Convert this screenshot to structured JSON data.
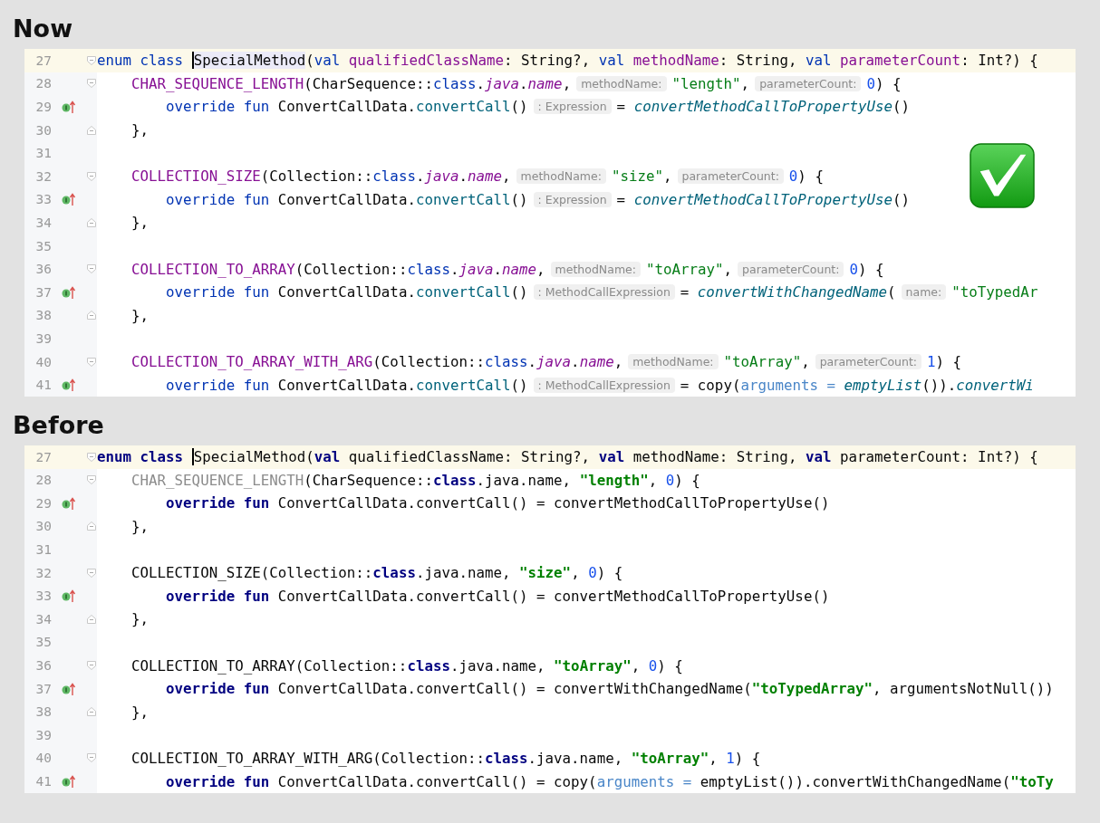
{
  "panels": [
    {
      "heading": "Now",
      "approved": true,
      "lines": [
        {
          "number": "27",
          "current": true,
          "override": false,
          "fold_start": true,
          "fold_end": false,
          "segments": [
            {
              "kind": "code",
              "tokens": [
                {
                  "kind": "kw",
                  "s": "enum class "
                },
                {
                  "kind": "sel",
                  "s": "SpecialMethod",
                  "cursor": true
                },
                {
                  "kind": "plain",
                  "s": "("
                },
                {
                  "kind": "kw",
                  "s": "val "
                },
                {
                  "kind": "enum",
                  "s": "qualifiedClassName"
                },
                {
                  "kind": "plain",
                  "s": ": String?, "
                },
                {
                  "kind": "kw",
                  "s": "val "
                },
                {
                  "kind": "enum",
                  "s": "methodName"
                },
                {
                  "kind": "plain",
                  "s": ": String, "
                },
                {
                  "kind": "kw",
                  "s": "val "
                },
                {
                  "kind": "enum",
                  "s": "parameterCount"
                },
                {
                  "kind": "plain",
                  "s": ": Int?) {"
                }
              ]
            }
          ]
        },
        {
          "number": "28",
          "current": false,
          "override": false,
          "fold_start": true,
          "fold_end": false,
          "segments": [
            {
              "kind": "code",
              "tokens": [
                {
                  "kind": "enum",
                  "s": "    CHAR_SEQUENCE_LENGTH"
                },
                {
                  "kind": "plain",
                  "s": "(CharSequence::"
                },
                {
                  "kind": "kw",
                  "s": "class"
                },
                {
                  "kind": "plain",
                  "s": "."
                },
                {
                  "kind": "ital",
                  "s": "java"
                },
                {
                  "kind": "plain",
                  "s": "."
                },
                {
                  "kind": "ital",
                  "s": "name"
                },
                {
                  "kind": "plain",
                  "s": ","
                }
              ]
            },
            {
              "kind": "hint",
              "text": "methodName:"
            },
            {
              "kind": "code",
              "tokens": [
                {
                  "kind": "str",
                  "s": "\"length\""
                },
                {
                  "kind": "plain",
                  "s": ","
                }
              ]
            },
            {
              "kind": "hint",
              "text": "parameterCount:"
            },
            {
              "kind": "code",
              "tokens": [
                {
                  "kind": "num",
                  "s": "0"
                },
                {
                  "kind": "plain",
                  "s": ") {"
                }
              ]
            }
          ]
        },
        {
          "number": "29",
          "current": false,
          "override": true,
          "fold_start": false,
          "fold_end": false,
          "segments": [
            {
              "kind": "code",
              "tokens": [
                {
                  "kind": "kw",
                  "s": "        override fun "
                },
                {
                  "kind": "plain",
                  "s": "ConvertCallData."
                },
                {
                  "kind": "fn",
                  "s": "convertCall"
                },
                {
                  "kind": "plain",
                  "s": "()"
                }
              ]
            },
            {
              "kind": "hint",
              "text": ": Expression"
            },
            {
              "kind": "code",
              "tokens": [
                {
                  "kind": "plain",
                  "s": "= "
                },
                {
                  "kind": "fni",
                  "s": "convertMethodCallToPropertyUse"
                },
                {
                  "kind": "plain",
                  "s": "()"
                }
              ]
            }
          ]
        },
        {
          "number": "30",
          "current": false,
          "override": false,
          "fold_start": false,
          "fold_end": true,
          "segments": [
            {
              "kind": "code",
              "tokens": [
                {
                  "kind": "plain",
                  "s": "    },"
                }
              ]
            }
          ]
        },
        {
          "number": "31",
          "current": false,
          "override": false,
          "fold_start": false,
          "fold_end": false
        },
        {
          "number": "32",
          "current": false,
          "override": false,
          "fold_start": true,
          "fold_end": false,
          "segments": [
            {
              "kind": "code",
              "tokens": [
                {
                  "kind": "enum",
                  "s": "    COLLECTION_SIZE"
                },
                {
                  "kind": "plain",
                  "s": "(Collection::"
                },
                {
                  "kind": "kw",
                  "s": "class"
                },
                {
                  "kind": "plain",
                  "s": "."
                },
                {
                  "kind": "ital",
                  "s": "java"
                },
                {
                  "kind": "plain",
                  "s": "."
                },
                {
                  "kind": "ital",
                  "s": "name"
                },
                {
                  "kind": "plain",
                  "s": ","
                }
              ]
            },
            {
              "kind": "hint",
              "text": "methodName:"
            },
            {
              "kind": "code",
              "tokens": [
                {
                  "kind": "str",
                  "s": "\"size\""
                },
                {
                  "kind": "plain",
                  "s": ","
                }
              ]
            },
            {
              "kind": "hint",
              "text": "parameterCount:"
            },
            {
              "kind": "code",
              "tokens": [
                {
                  "kind": "num",
                  "s": "0"
                },
                {
                  "kind": "plain",
                  "s": ") {"
                }
              ]
            }
          ]
        },
        {
          "number": "33",
          "current": false,
          "override": true,
          "fold_start": false,
          "fold_end": false,
          "segments": [
            {
              "kind": "code",
              "tokens": [
                {
                  "kind": "kw",
                  "s": "        override fun "
                },
                {
                  "kind": "plain",
                  "s": "ConvertCallData."
                },
                {
                  "kind": "fn",
                  "s": "convertCall"
                },
                {
                  "kind": "plain",
                  "s": "()"
                }
              ]
            },
            {
              "kind": "hint",
              "text": ": Expression"
            },
            {
              "kind": "code",
              "tokens": [
                {
                  "kind": "plain",
                  "s": "= "
                },
                {
                  "kind": "fni",
                  "s": "convertMethodCallToPropertyUse"
                },
                {
                  "kind": "plain",
                  "s": "()"
                }
              ]
            }
          ]
        },
        {
          "number": "34",
          "current": false,
          "override": false,
          "fold_start": false,
          "fold_end": true,
          "segments": [
            {
              "kind": "code",
              "tokens": [
                {
                  "kind": "plain",
                  "s": "    },"
                }
              ]
            }
          ]
        },
        {
          "number": "35",
          "current": false,
          "override": false,
          "fold_start": false,
          "fold_end": false
        },
        {
          "number": "36",
          "current": false,
          "override": false,
          "fold_start": true,
          "fold_end": false,
          "segments": [
            {
              "kind": "code",
              "tokens": [
                {
                  "kind": "enum",
                  "s": "    COLLECTION_TO_ARRAY"
                },
                {
                  "kind": "plain",
                  "s": "(Collection::"
                },
                {
                  "kind": "kw",
                  "s": "class"
                },
                {
                  "kind": "plain",
                  "s": "."
                },
                {
                  "kind": "ital",
                  "s": "java"
                },
                {
                  "kind": "plain",
                  "s": "."
                },
                {
                  "kind": "ital",
                  "s": "name"
                },
                {
                  "kind": "plain",
                  "s": ","
                }
              ]
            },
            {
              "kind": "hint",
              "text": "methodName:"
            },
            {
              "kind": "code",
              "tokens": [
                {
                  "kind": "str",
                  "s": "\"toArray\""
                },
                {
                  "kind": "plain",
                  "s": ","
                }
              ]
            },
            {
              "kind": "hint",
              "text": "parameterCount:"
            },
            {
              "kind": "code",
              "tokens": [
                {
                  "kind": "num",
                  "s": "0"
                },
                {
                  "kind": "plain",
                  "s": ") {"
                }
              ]
            }
          ]
        },
        {
          "number": "37",
          "current": false,
          "override": true,
          "fold_start": false,
          "fold_end": false,
          "segments": [
            {
              "kind": "code",
              "tokens": [
                {
                  "kind": "kw",
                  "s": "        override fun "
                },
                {
                  "kind": "plain",
                  "s": "ConvertCallData."
                },
                {
                  "kind": "fn",
                  "s": "convertCall"
                },
                {
                  "kind": "plain",
                  "s": "()"
                }
              ]
            },
            {
              "kind": "hint",
              "text": ": MethodCallExpression"
            },
            {
              "kind": "code",
              "tokens": [
                {
                  "kind": "plain",
                  "s": "= "
                },
                {
                  "kind": "fni",
                  "s": "convertWithChangedName"
                },
                {
                  "kind": "plain",
                  "s": "("
                }
              ]
            },
            {
              "kind": "hint",
              "text": "name:"
            },
            {
              "kind": "code",
              "tokens": [
                {
                  "kind": "str",
                  "s": "\"toTypedAr"
                }
              ]
            }
          ]
        },
        {
          "number": "38",
          "current": false,
          "override": false,
          "fold_start": false,
          "fold_end": true,
          "segments": [
            {
              "kind": "code",
              "tokens": [
                {
                  "kind": "plain",
                  "s": "    },"
                }
              ]
            }
          ]
        },
        {
          "number": "39",
          "current": false,
          "override": false,
          "fold_start": false,
          "fold_end": false
        },
        {
          "number": "40",
          "current": false,
          "override": false,
          "fold_start": true,
          "fold_end": false,
          "segments": [
            {
              "kind": "code",
              "tokens": [
                {
                  "kind": "enum",
                  "s": "    COLLECTION_TO_ARRAY_WITH_ARG"
                },
                {
                  "kind": "plain",
                  "s": "(Collection::"
                },
                {
                  "kind": "kw",
                  "s": "class"
                },
                {
                  "kind": "plain",
                  "s": "."
                },
                {
                  "kind": "ital",
                  "s": "java"
                },
                {
                  "kind": "plain",
                  "s": "."
                },
                {
                  "kind": "ital",
                  "s": "name"
                },
                {
                  "kind": "plain",
                  "s": ","
                }
              ]
            },
            {
              "kind": "hint",
              "text": "methodName:"
            },
            {
              "kind": "code",
              "tokens": [
                {
                  "kind": "str",
                  "s": "\"toArray\""
                },
                {
                  "kind": "plain",
                  "s": ","
                }
              ]
            },
            {
              "kind": "hint",
              "text": "parameterCount:"
            },
            {
              "kind": "code",
              "tokens": [
                {
                  "kind": "num",
                  "s": "1"
                },
                {
                  "kind": "plain",
                  "s": ") {"
                }
              ]
            }
          ]
        },
        {
          "number": "41",
          "current": false,
          "override": true,
          "fold_start": false,
          "fold_end": false,
          "segments": [
            {
              "kind": "code",
              "tokens": [
                {
                  "kind": "kw",
                  "s": "        override fun "
                },
                {
                  "kind": "plain",
                  "s": "ConvertCallData."
                },
                {
                  "kind": "fn",
                  "s": "convertCall"
                },
                {
                  "kind": "plain",
                  "s": "()"
                }
              ]
            },
            {
              "kind": "hint",
              "text": ": MethodCallExpression"
            },
            {
              "kind": "code",
              "tokens": [
                {
                  "kind": "plain",
                  "s": "= copy("
                },
                {
                  "kind": "named",
                  "s": "arguments = "
                },
                {
                  "kind": "fni",
                  "s": "emptyList"
                },
                {
                  "kind": "plain",
                  "s": "())."
                },
                {
                  "kind": "fni",
                  "s": "convertWi"
                }
              ]
            }
          ]
        }
      ]
    },
    {
      "heading": "Before",
      "approved": false,
      "lines": [
        {
          "number": "27",
          "current": true,
          "override": false,
          "fold_start": true,
          "fold_end": false,
          "segments": [
            {
              "kind": "code",
              "tokens": [
                {
                  "kind": "kwb",
                  "s": "enum class "
                },
                {
                  "kind": "plain",
                  "s": "SpecialMethod",
                  "cursor": true
                },
                {
                  "kind": "plain",
                  "s": "("
                },
                {
                  "kind": "kwb",
                  "s": "val "
                },
                {
                  "kind": "plain",
                  "s": "qualifiedClassName: String?, "
                },
                {
                  "kind": "kwb",
                  "s": "val "
                },
                {
                  "kind": "plain",
                  "s": "methodName: String, "
                },
                {
                  "kind": "kwb",
                  "s": "val "
                },
                {
                  "kind": "plain",
                  "s": "parameterCount: Int?) {"
                }
              ]
            }
          ]
        },
        {
          "number": "28",
          "current": false,
          "override": false,
          "fold_start": true,
          "fold_end": false,
          "segments": [
            {
              "kind": "code",
              "tokens": [
                {
                  "kind": "unused",
                  "s": "    CHAR_SEQUENCE_LENGTH"
                },
                {
                  "kind": "plain",
                  "s": "(CharSequence::"
                },
                {
                  "kind": "kwb",
                  "s": "class"
                },
                {
                  "kind": "plain",
                  "s": ".java.name, "
                },
                {
                  "kind": "strb",
                  "s": "\"length\""
                },
                {
                  "kind": "plain",
                  "s": ", "
                },
                {
                  "kind": "num",
                  "s": "0"
                },
                {
                  "kind": "plain",
                  "s": ") {"
                }
              ]
            }
          ]
        },
        {
          "number": "29",
          "current": false,
          "override": true,
          "fold_start": false,
          "fold_end": false,
          "segments": [
            {
              "kind": "code",
              "tokens": [
                {
                  "kind": "kwb",
                  "s": "        override fun "
                },
                {
                  "kind": "plain",
                  "s": "ConvertCallData.convertCall() = convertMethodCallToPropertyUse()"
                }
              ]
            }
          ]
        },
        {
          "number": "30",
          "current": false,
          "override": false,
          "fold_start": false,
          "fold_end": true,
          "segments": [
            {
              "kind": "code",
              "tokens": [
                {
                  "kind": "plain",
                  "s": "    },"
                }
              ]
            }
          ]
        },
        {
          "number": "31",
          "current": false,
          "override": false,
          "fold_start": false,
          "fold_end": false
        },
        {
          "number": "32",
          "current": false,
          "override": false,
          "fold_start": true,
          "fold_end": false,
          "segments": [
            {
              "kind": "code",
              "tokens": [
                {
                  "kind": "plain",
                  "s": "    COLLECTION_SIZE(Collection::"
                },
                {
                  "kind": "kwb",
                  "s": "class"
                },
                {
                  "kind": "plain",
                  "s": ".java.name, "
                },
                {
                  "kind": "strb",
                  "s": "\"size\""
                },
                {
                  "kind": "plain",
                  "s": ", "
                },
                {
                  "kind": "num",
                  "s": "0"
                },
                {
                  "kind": "plain",
                  "s": ") {"
                }
              ]
            }
          ]
        },
        {
          "number": "33",
          "current": false,
          "override": true,
          "fold_start": false,
          "fold_end": false,
          "segments": [
            {
              "kind": "code",
              "tokens": [
                {
                  "kind": "kwb",
                  "s": "        override fun "
                },
                {
                  "kind": "plain",
                  "s": "ConvertCallData.convertCall() = convertMethodCallToPropertyUse()"
                }
              ]
            }
          ]
        },
        {
          "number": "34",
          "current": false,
          "override": false,
          "fold_start": false,
          "fold_end": true,
          "segments": [
            {
              "kind": "code",
              "tokens": [
                {
                  "kind": "plain",
                  "s": "    },"
                }
              ]
            }
          ]
        },
        {
          "number": "35",
          "current": false,
          "override": false,
          "fold_start": false,
          "fold_end": false
        },
        {
          "number": "36",
          "current": false,
          "override": false,
          "fold_start": true,
          "fold_end": false,
          "segments": [
            {
              "kind": "code",
              "tokens": [
                {
                  "kind": "plain",
                  "s": "    COLLECTION_TO_ARRAY(Collection::"
                },
                {
                  "kind": "kwb",
                  "s": "class"
                },
                {
                  "kind": "plain",
                  "s": ".java.name, "
                },
                {
                  "kind": "strb",
                  "s": "\"toArray\""
                },
                {
                  "kind": "plain",
                  "s": ", "
                },
                {
                  "kind": "num",
                  "s": "0"
                },
                {
                  "kind": "plain",
                  "s": ") {"
                }
              ]
            }
          ]
        },
        {
          "number": "37",
          "current": false,
          "override": true,
          "fold_start": false,
          "fold_end": false,
          "segments": [
            {
              "kind": "code",
              "tokens": [
                {
                  "kind": "kwb",
                  "s": "        override fun "
                },
                {
                  "kind": "plain",
                  "s": "ConvertCallData.convertCall() = convertWithChangedName("
                },
                {
                  "kind": "strb",
                  "s": "\"toTypedArray\""
                },
                {
                  "kind": "plain",
                  "s": ", argumentsNotNull())"
                }
              ]
            }
          ]
        },
        {
          "number": "38",
          "current": false,
          "override": false,
          "fold_start": false,
          "fold_end": true,
          "segments": [
            {
              "kind": "code",
              "tokens": [
                {
                  "kind": "plain",
                  "s": "    },"
                }
              ]
            }
          ]
        },
        {
          "number": "39",
          "current": false,
          "override": false,
          "fold_start": false,
          "fold_end": false
        },
        {
          "number": "40",
          "current": false,
          "override": false,
          "fold_start": true,
          "fold_end": false,
          "segments": [
            {
              "kind": "code",
              "tokens": [
                {
                  "kind": "plain",
                  "s": "    COLLECTION_TO_ARRAY_WITH_ARG(Collection::"
                },
                {
                  "kind": "kwb",
                  "s": "class"
                },
                {
                  "kind": "plain",
                  "s": ".java.name, "
                },
                {
                  "kind": "strb",
                  "s": "\"toArray\""
                },
                {
                  "kind": "plain",
                  "s": ", "
                },
                {
                  "kind": "num",
                  "s": "1"
                },
                {
                  "kind": "plain",
                  "s": ") {"
                }
              ]
            }
          ]
        },
        {
          "number": "41",
          "current": false,
          "override": true,
          "fold_start": false,
          "fold_end": false,
          "segments": [
            {
              "kind": "code",
              "tokens": [
                {
                  "kind": "kwb",
                  "s": "        override fun "
                },
                {
                  "kind": "plain",
                  "s": "ConvertCallData.convertCall() = copy("
                },
                {
                  "kind": "named",
                  "s": "arguments = "
                },
                {
                  "kind": "plain",
                  "s": "emptyList()).convertWithChangedName("
                },
                {
                  "kind": "strb",
                  "s": "\"toTy"
                }
              ]
            }
          ]
        }
      ]
    }
  ]
}
